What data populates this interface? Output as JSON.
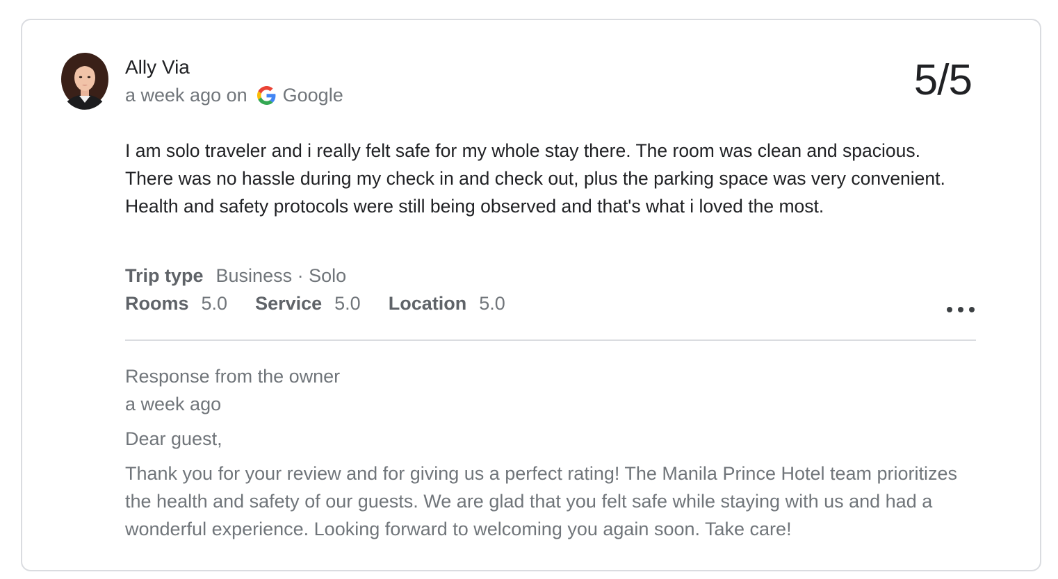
{
  "review": {
    "reviewer_name": "Ally Via",
    "time": "a week ago on",
    "source": "Google",
    "source_icon": "google-g-icon",
    "score": "5/5",
    "text": "I am solo traveler and i really felt safe for my whole stay there. The room was clean and spacious. There was no hassle during my check in and check out, plus the parking space was very convenient. Health and safety protocols were still being observed and that's what i loved the most.",
    "trip_type_label": "Trip type",
    "trip_type_value": "Business · Solo",
    "ratings": [
      {
        "label": "Rooms",
        "value": "5.0"
      },
      {
        "label": "Service",
        "value": "5.0"
      },
      {
        "label": "Location",
        "value": "5.0"
      }
    ],
    "more_icon": "more-horizontal-icon"
  },
  "owner_response": {
    "title": "Response from the owner",
    "time": "a week ago",
    "greeting": "Dear guest,",
    "body": "Thank you for your review and for giving us a perfect rating! The Manila Prince Hotel team prioritizes the health and safety of our guests. We are glad that you felt safe while staying with us and had a wonderful experience. Looking forward to welcoming you again soon. Take care!"
  },
  "colors": {
    "primary_text": "#202124",
    "secondary_text": "#70757a",
    "border": "#dadce0"
  }
}
